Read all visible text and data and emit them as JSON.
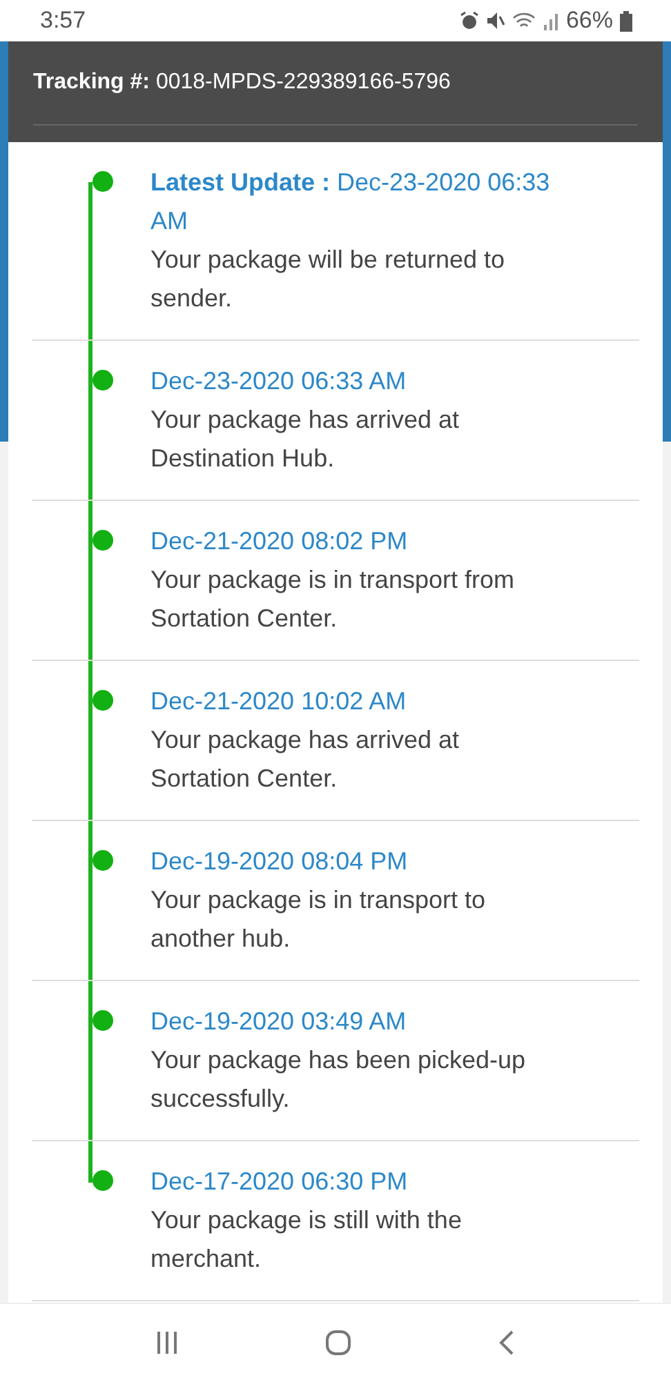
{
  "status_bar": {
    "time": "3:57",
    "battery": "66%"
  },
  "header": {
    "label": "Tracking #:",
    "value": "0018-MPDS-229389166-5796"
  },
  "events": [
    {
      "date": "**Latest Update :** Dec-23-2020 06:33 AM",
      "message": "Your package will be returned to sender."
    },
    {
      "date": "Dec-23-2020 06:33 AM",
      "message": "Your package has arrived at Destination Hub."
    },
    {
      "date": "Dec-21-2020 08:02 PM",
      "message": "Your package is in transport from Sortation Center."
    },
    {
      "date": "Dec-21-2020 10:02 AM",
      "message": "Your package has arrived at Sortation Center."
    },
    {
      "date": "Dec-19-2020 08:04 PM",
      "message": "Your package is in transport to another hub."
    },
    {
      "date": "Dec-19-2020 03:49 AM",
      "message": "Your package has been picked-up successfully."
    },
    {
      "date": "Dec-17-2020 06:30 PM",
      "message": "Your package is still with the merchant."
    }
  ]
}
